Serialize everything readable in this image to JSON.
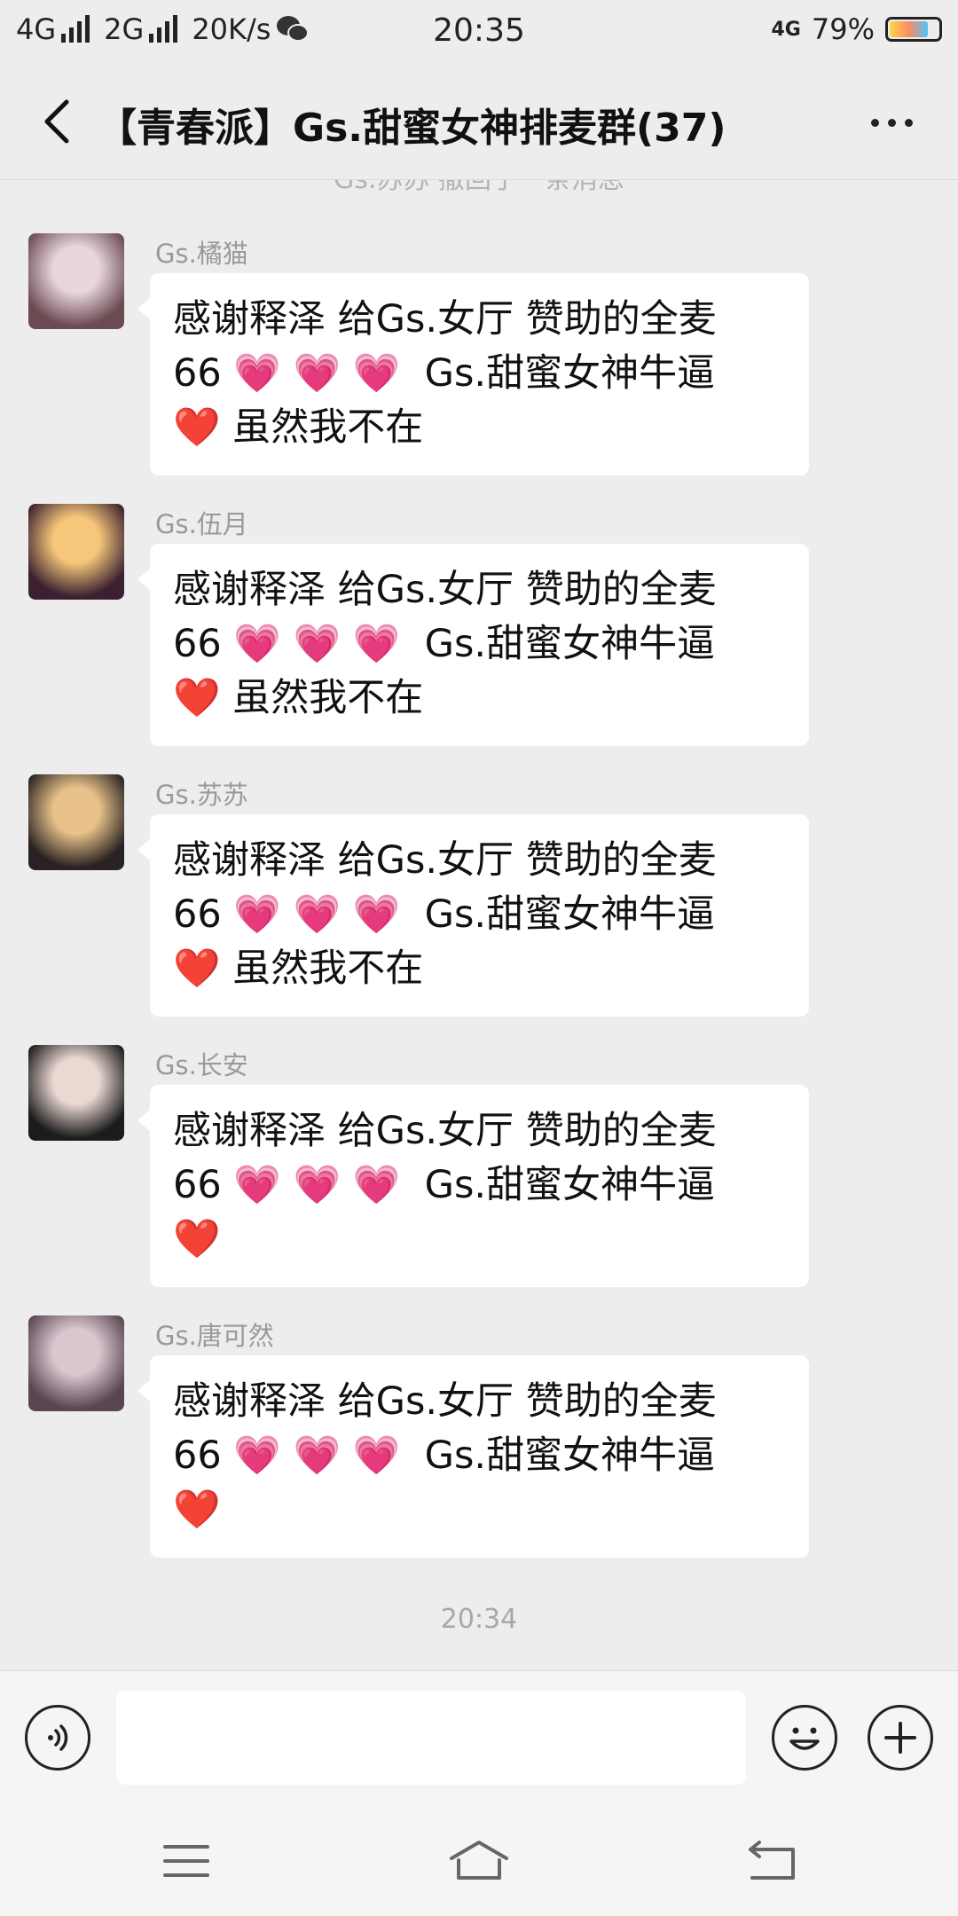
{
  "status_bar": {
    "signal1": "4G",
    "signal2": "2G",
    "speed": "20K/s",
    "time": "20:35",
    "net_type": "4G",
    "battery": "79%",
    "battery_level": 0.79
  },
  "nav": {
    "title": "【青春派】Gs.甜蜜女神排麦群(37)"
  },
  "chat": {
    "cut_notice": "Gs.苏苏  撤回了一条消息",
    "messages": [
      {
        "sender": "Gs.橘猫",
        "line1": "感谢释泽 给Gs.女厅 赞助的全麦",
        "line2": "66 💗 💗 💗  Gs.甜蜜女神牛逼",
        "line3": "❤️ 虽然我不在",
        "avatar_colors": [
          "#e8d6dc",
          "#6b4a52"
        ]
      },
      {
        "sender": "Gs.伍月",
        "line1": "感谢释泽 给Gs.女厅 赞助的全麦",
        "line2": "66 💗 💗 💗  Gs.甜蜜女神牛逼",
        "line3": "❤️ 虽然我不在",
        "avatar_colors": [
          "#f6c77a",
          "#3a2030"
        ]
      },
      {
        "sender": "Gs.苏苏",
        "line1": "感谢释泽 给Gs.女厅 赞助的全麦",
        "line2": "66 💗 💗 💗  Gs.甜蜜女神牛逼",
        "line3": "❤️ 虽然我不在",
        "avatar_colors": [
          "#e8c28a",
          "#2a2222"
        ]
      },
      {
        "sender": "Gs.长安",
        "line1": "感谢释泽 给Gs.女厅 赞助的全麦",
        "line2": "66 💗 💗 💗  Gs.甜蜜女神牛逼",
        "line3": "❤️",
        "avatar_colors": [
          "#ead8d2",
          "#1c1c1c"
        ]
      },
      {
        "sender": "Gs.唐可然",
        "line1": "感谢释泽 给Gs.女厅 赞助的全麦",
        "line2": "66 💗 💗 💗  Gs.甜蜜女神牛逼",
        "line3": "❤️",
        "avatar_colors": [
          "#d9c6cf",
          "#5a4650"
        ]
      }
    ],
    "timestamp": "20:34"
  },
  "input_bar": {
    "value": "",
    "placeholder": ""
  },
  "icons": {
    "back": "chevron-left-icon",
    "more": "more-dots-icon",
    "voice": "voice-icon",
    "emoji": "emoji-icon",
    "plus": "plus-icon",
    "menu": "menu-icon",
    "home": "home-icon",
    "return": "return-icon"
  }
}
